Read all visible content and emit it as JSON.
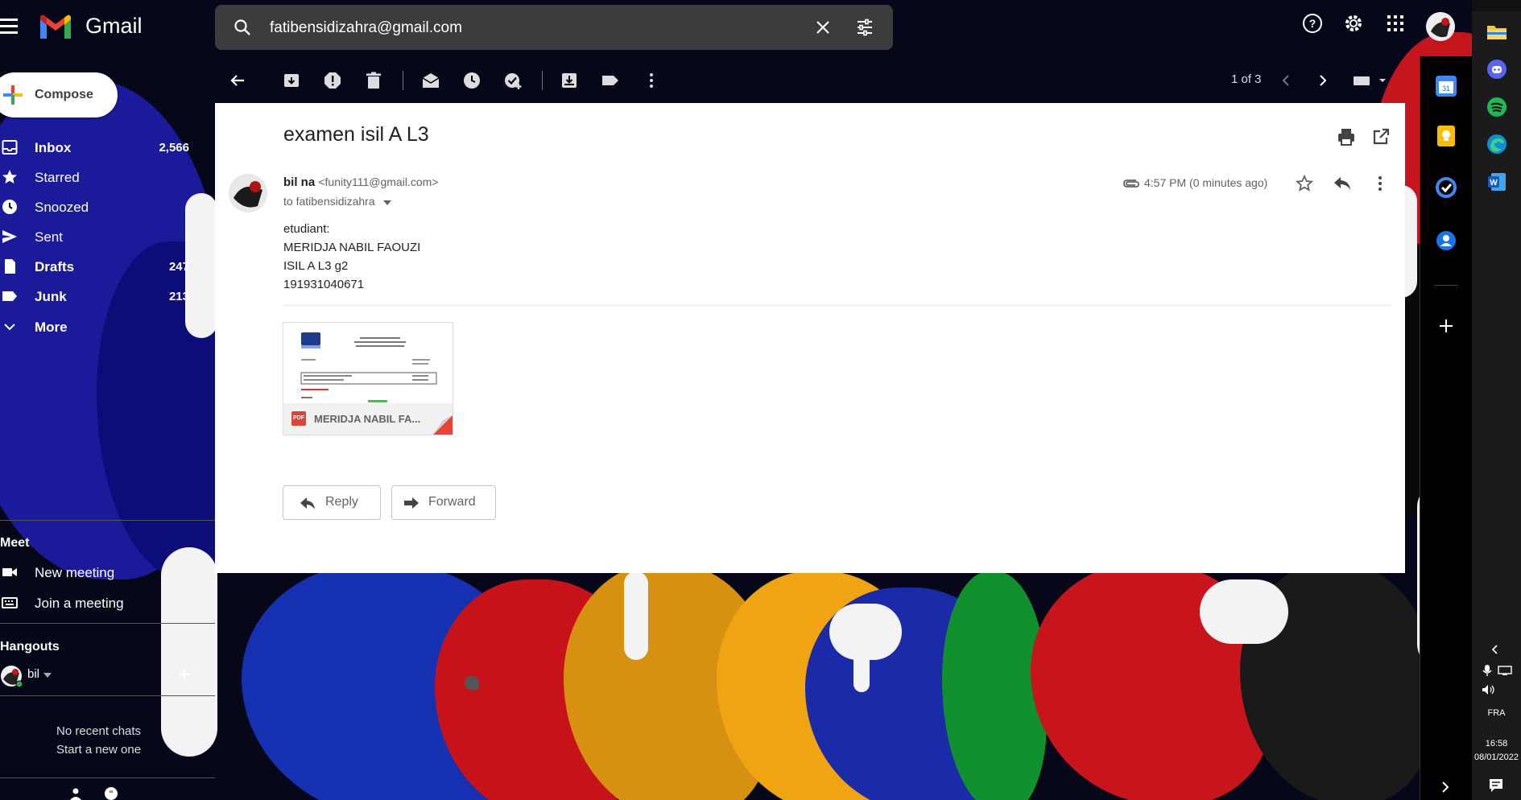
{
  "app": {
    "name": "Gmail"
  },
  "search": {
    "value": "fatibensidizahra@gmail.com"
  },
  "compose": {
    "label": "Compose"
  },
  "nav": [
    {
      "label": "Inbox",
      "count": "2,566",
      "bold": true
    },
    {
      "label": "Starred",
      "count": ""
    },
    {
      "label": "Snoozed",
      "count": ""
    },
    {
      "label": "Sent",
      "count": ""
    },
    {
      "label": "Drafts",
      "count": "247",
      "bold": true
    },
    {
      "label": "Junk",
      "count": "213",
      "bold": true
    },
    {
      "label": "More",
      "count": ""
    }
  ],
  "meet": {
    "header": "Meet",
    "new_meeting": "New meeting",
    "join_meeting": "Join a meeting"
  },
  "hangouts": {
    "header": "Hangouts",
    "user": "bil",
    "no_chats": "No recent chats",
    "start_new": "Start a new one"
  },
  "toolbar": {
    "pager": "1 of 3"
  },
  "message": {
    "subject": "examen isil A L3",
    "sender_name": "bil na",
    "sender_email": "<funity111@gmail.com>",
    "to": "to fatibensidizahra",
    "time": "4:57 PM (0 minutes ago)",
    "body": [
      "etudiant:",
      "MERIDJA NABIL  FAOUZI",
      "ISIL A  L3 g2",
      "191931040671"
    ],
    "attachment": {
      "badge": "PDF",
      "name": "MERIDJA NABIL FA..."
    },
    "reply_label": "Reply",
    "forward_label": "Forward"
  },
  "taskbar": {
    "lang": "FRA",
    "time": "16:58",
    "date": "08/01/2022"
  },
  "colors": {
    "card_bg": "#ffffff",
    "search_bg": "#3c3c3c",
    "accent_red": "#db4437",
    "taskbar_bg": "#1b1b1b"
  }
}
